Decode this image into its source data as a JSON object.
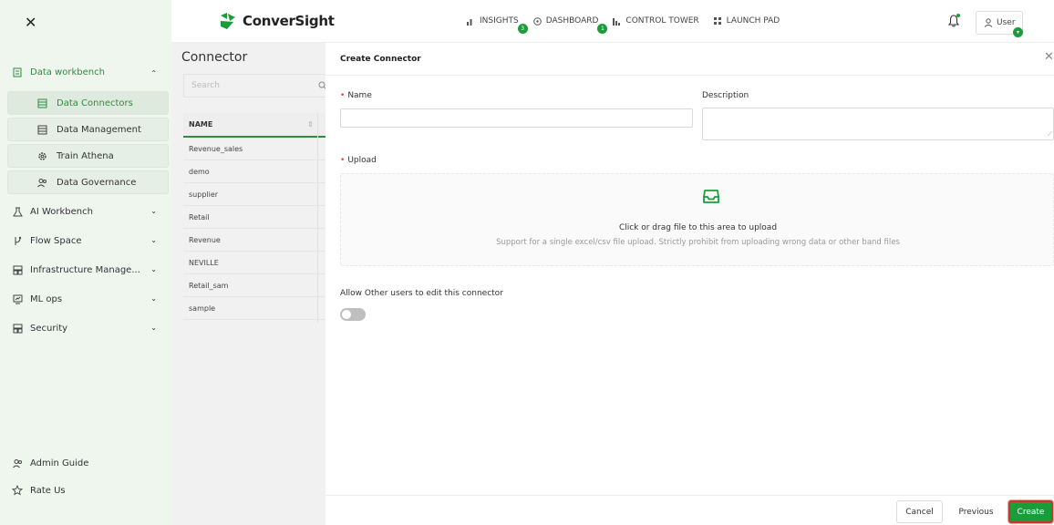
{
  "header": {
    "close_icon": "✕",
    "logo_text": "ConverSight",
    "nav": [
      {
        "label": "INSIGHTS",
        "icon": "bar-chart-icon",
        "badge": "3"
      },
      {
        "label": "DASHBOARD",
        "icon": "gauge-icon",
        "badge": "1"
      },
      {
        "label": "CONTROL TOWER",
        "icon": "tower-icon",
        "badge": ""
      },
      {
        "label": "LAUNCH PAD",
        "icon": "grid-icon",
        "badge": ""
      }
    ],
    "user_label": "User",
    "user_badge": "▾"
  },
  "sidebar": {
    "groups": [
      {
        "label": "Data workbench",
        "chevron": "⌃",
        "icon": "database-icon"
      },
      {
        "label": "AI Workbench",
        "chevron": "⌄",
        "icon": "flask-icon"
      },
      {
        "label": "Flow Space",
        "chevron": "⌄",
        "icon": "branch-icon"
      },
      {
        "label": "Infrastructure Manage...",
        "chevron": "⌄",
        "icon": "server-icon"
      },
      {
        "label": "ML ops",
        "chevron": "⌄",
        "icon": "monitor-icon"
      },
      {
        "label": "Security",
        "chevron": "⌄",
        "icon": "shield-icon"
      }
    ],
    "sub_items": [
      {
        "label": "Data Connectors"
      },
      {
        "label": "Data Management"
      },
      {
        "label": "Train Athena"
      },
      {
        "label": "Data Governance"
      }
    ],
    "bottom": [
      {
        "label": "Admin Guide"
      },
      {
        "label": "Rate Us"
      }
    ]
  },
  "connector_list": {
    "title": "Connector",
    "search_placeholder": "Search",
    "column_header": "NAME",
    "sort_glyph": "⇕",
    "rows": [
      "Revenue_sales",
      "demo",
      "supplier",
      "Retail",
      "Revenue",
      "NEVILLE",
      "Retail_sam",
      "sample"
    ]
  },
  "modal": {
    "title": "Create Connector",
    "close_glyph": "✕",
    "required_mark": "•",
    "name_label": "Name",
    "description_label": "Description",
    "upload_label": "Upload",
    "upload_main_text": "Click or drag file to this area to upload",
    "upload_hint_text": "Support for a single excel/csv file upload. Strictly prohibit from uploading wrong data or other band files",
    "allow_edit_label": "Allow Other users to edit this connector",
    "allow_edit_enabled": false,
    "buttons": {
      "cancel": "Cancel",
      "previous": "Previous",
      "create": "Create"
    }
  },
  "colors": {
    "accent": "#1a9c3a",
    "sidebar_bg": "#eef6ee",
    "required": "#e0443c"
  }
}
